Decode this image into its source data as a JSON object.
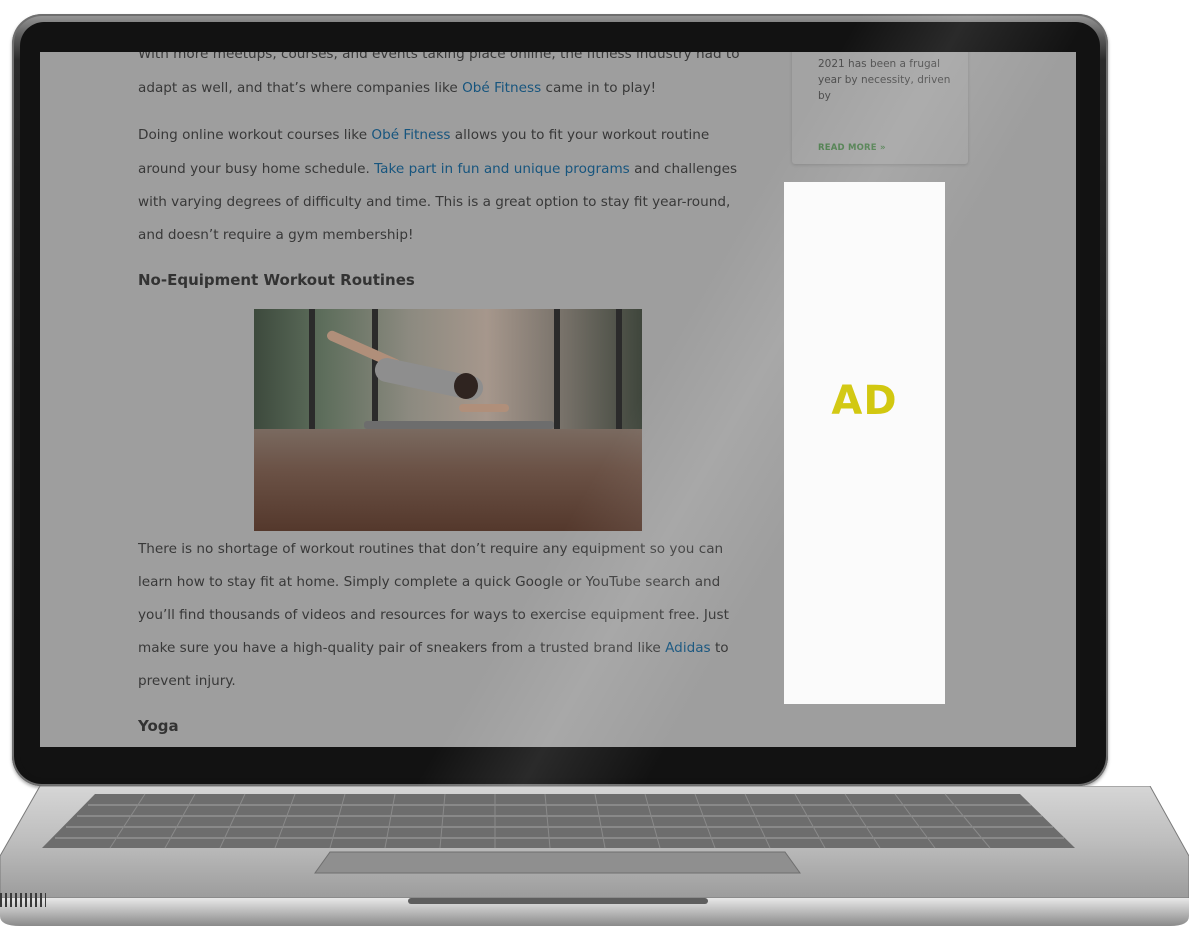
{
  "article": {
    "lines_top": [
      {
        "text": "With more meetups, courses, and events taking place online, the fitness industry had to",
        "y": 0
      },
      {
        "parts": [
          {
            "t": "adapt as well, and that’s where companies like "
          },
          {
            "t": "Obé Fitness",
            "link": true
          },
          {
            "t": " came in to play!"
          }
        ]
      },
      {
        "parts": [
          {
            "t": "Doing online workout courses like "
          },
          {
            "t": "Obé Fitness",
            "link": true
          },
          {
            "t": " allows you to fit your workout routine"
          }
        ]
      },
      {
        "parts": [
          {
            "t": "around your busy home schedule. "
          },
          {
            "t": "Take part in fun and unique programs",
            "link": true
          },
          {
            "t": " and challenges"
          }
        ]
      },
      {
        "parts": [
          {
            "t": "with varying degrees of difficulty and time. This is a great option to stay fit year-round,"
          }
        ]
      },
      {
        "parts": [
          {
            "t": "and doesn’t require a gym membership!"
          }
        ]
      }
    ],
    "heading_1": "No-Equipment Workout Routines",
    "lines_bottom": [
      {
        "parts": [
          {
            "t": "There is no shortage of workout routines that don’t require any equipment so you can"
          }
        ]
      },
      {
        "parts": [
          {
            "t": "learn how to stay fit at home. Simply complete a quick Google or YouTube search and"
          }
        ]
      },
      {
        "parts": [
          {
            "t": "you’ll find thousands of videos and resources for ways to exercise equipment free. Just"
          }
        ]
      },
      {
        "parts": [
          {
            "t": "make sure you have a high-quality pair of sneakers from a trusted brand like "
          },
          {
            "t": "Adidas",
            "link": true
          },
          {
            "t": " to"
          }
        ]
      },
      {
        "parts": [
          {
            "t": "prevent injury."
          }
        ]
      }
    ],
    "heading_2": "Yoga"
  },
  "sidebar": {
    "excerpt": "2021 has been a frugal year by necessity, driven by",
    "read_more": "READ MORE »"
  },
  "ad": {
    "label": "AD",
    "label_color": "#d2c810"
  },
  "colors": {
    "link": "#17557e",
    "overlay_gray": "#9e9e9e"
  }
}
